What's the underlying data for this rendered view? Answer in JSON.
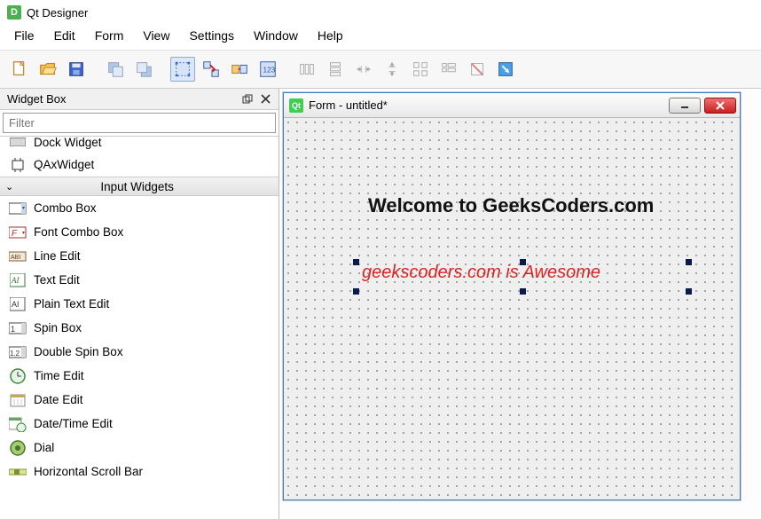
{
  "app": {
    "title": "Qt Designer",
    "iconLetter": "D"
  },
  "menu": [
    "File",
    "Edit",
    "Form",
    "View",
    "Settings",
    "Window",
    "Help"
  ],
  "widgetBox": {
    "title": "Widget Box",
    "filterPlaceholder": "Filter",
    "partialItems": [
      "Dock Widget",
      "QAxWidget"
    ],
    "sectionHeader": "Input Widgets",
    "items": [
      "Combo Box",
      "Font Combo Box",
      "Line Edit",
      "Text Edit",
      "Plain Text Edit",
      "Spin Box",
      "Double Spin Box",
      "Time Edit",
      "Date Edit",
      "Date/Time Edit",
      "Dial",
      "Horizontal Scroll Bar"
    ]
  },
  "form": {
    "title": "Form - untitled*",
    "label1": "Welcome to GeeksCoders.com",
    "label2": "geekscoders.com is Awesome"
  }
}
